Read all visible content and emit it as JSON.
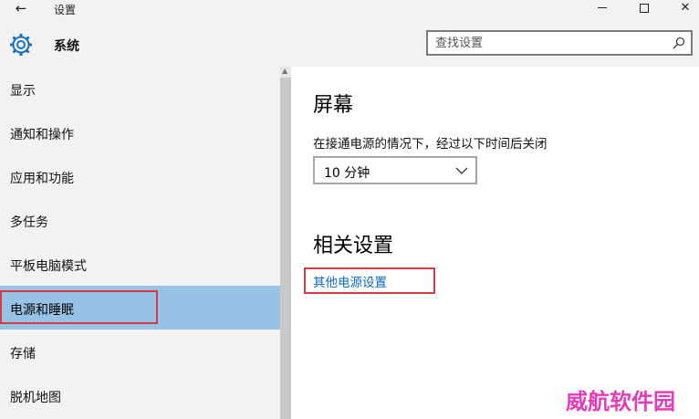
{
  "window": {
    "title": "设置",
    "back_icon": "back-arrow-icon",
    "controls": {
      "minimize": "minimize-icon",
      "maximize": "maximize-icon",
      "close": "✕"
    }
  },
  "header": {
    "icon": "gear-icon",
    "title": "系统",
    "search_placeholder": "查找设置"
  },
  "sidebar": {
    "items": [
      {
        "label": "显示",
        "selected": false
      },
      {
        "label": "通知和操作",
        "selected": false
      },
      {
        "label": "应用和功能",
        "selected": false
      },
      {
        "label": "多任务",
        "selected": false
      },
      {
        "label": "平板电脑模式",
        "selected": false
      },
      {
        "label": "电源和睡眠",
        "selected": true
      },
      {
        "label": "存储",
        "selected": false
      },
      {
        "label": "脱机地图",
        "selected": false
      }
    ]
  },
  "main": {
    "screen_heading": "屏幕",
    "screen_description": "在接通电源的情况下，经过以下时间后关闭",
    "screen_timeout": "10 分钟",
    "related_heading": "相关设置",
    "related_link": "其他电源设置"
  },
  "colors": {
    "accent": "#0b6ab1",
    "selection": "#97c2e6",
    "highlight_box": "#d93a3f",
    "watermark": "#e23db8"
  },
  "watermark": "威航软件园"
}
